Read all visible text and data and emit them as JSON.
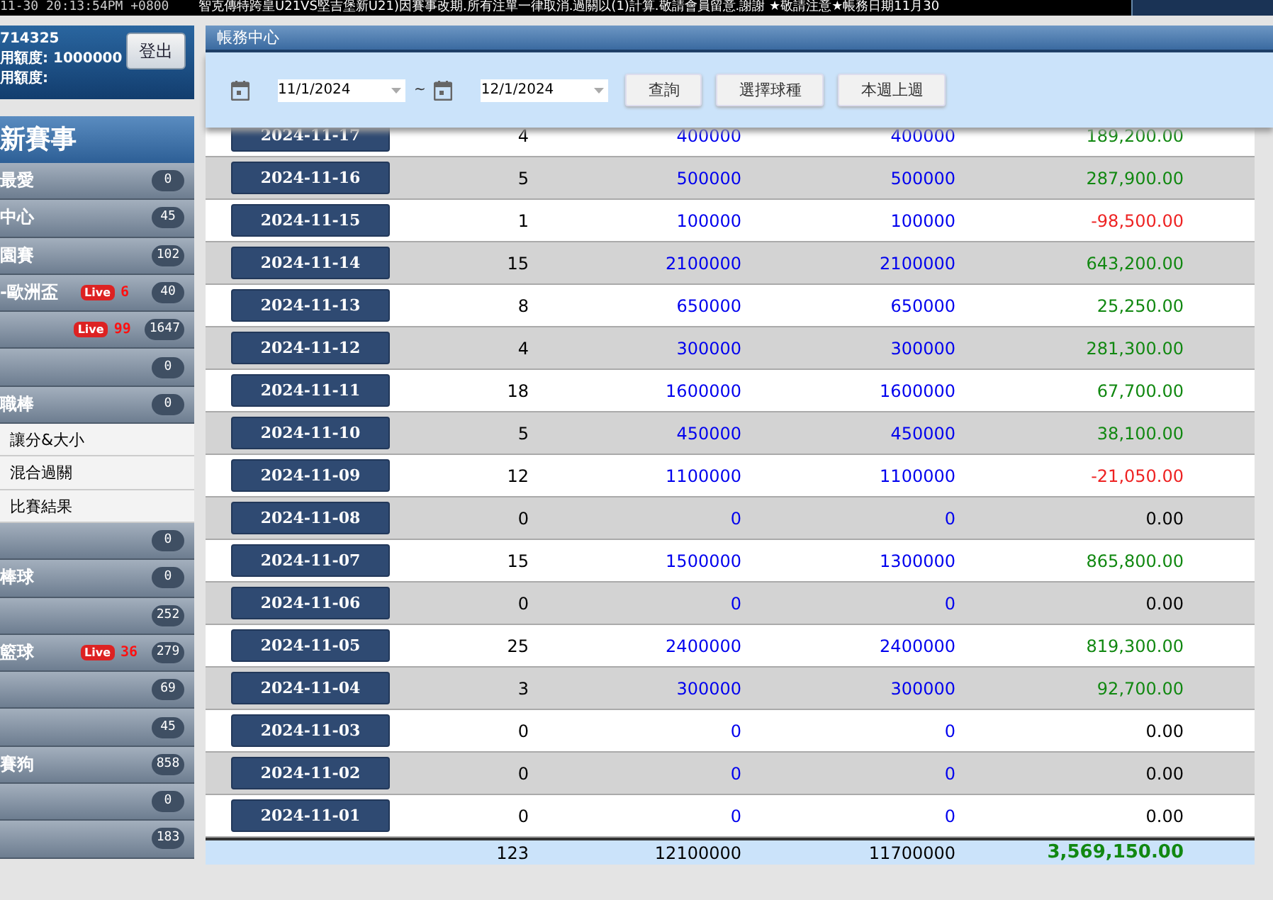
{
  "top_bar": {
    "clock": "11-30 20:13:54PM +0800",
    "marquee": "智克傳特跨皇U21VS堅吉堡新U21)因賽事改期.所有注單一律取消.過關以(1)計算.敬請會員留意.謝謝 ★敬請注意★帳務日期11月30"
  },
  "account": {
    "id": "714325",
    "credit_label": "用額度:",
    "credit_value": "1000000",
    "balance_label": "用額度:",
    "logout": "登出"
  },
  "sidebar": {
    "title": "新賽事",
    "items": [
      {
        "kind": "sport",
        "label": "最愛",
        "count": "0"
      },
      {
        "kind": "sport",
        "label": "中心",
        "count": "45"
      },
      {
        "kind": "sport",
        "label": "園賽",
        "count": "102"
      },
      {
        "kind": "sport",
        "label": "-歐洲盃",
        "live_badge": "Live",
        "live": "6",
        "count": "40"
      },
      {
        "kind": "sport",
        "live_badge": "Live",
        "live": "99",
        "count": "1647"
      },
      {
        "kind": "sport",
        "count": "0"
      },
      {
        "kind": "sport",
        "label": "職棒",
        "count": "0"
      },
      {
        "kind": "sub",
        "label": "讓分&大小"
      },
      {
        "kind": "sub",
        "label": "混合過關"
      },
      {
        "kind": "sub",
        "label": "比賽結果"
      },
      {
        "kind": "sport",
        "count": "0"
      },
      {
        "kind": "sport",
        "label": "棒球",
        "count": "0"
      },
      {
        "kind": "sport",
        "count": "252"
      },
      {
        "kind": "sport",
        "label": "籃球",
        "live_badge": "Live",
        "live": "36",
        "count": "279"
      },
      {
        "kind": "sport",
        "count": "69"
      },
      {
        "kind": "sport",
        "count": "45"
      },
      {
        "kind": "sport",
        "label": "賽狗",
        "count": "858"
      },
      {
        "kind": "sport",
        "count": "0"
      },
      {
        "kind": "sport",
        "count": "183"
      }
    ]
  },
  "panel": {
    "title": "帳務中心",
    "date_from": "11/1/2024",
    "separator": "~",
    "date_to": "12/1/2024",
    "buttons": [
      "查詢",
      "選擇球種",
      "本週上週"
    ]
  },
  "table": {
    "rows": [
      {
        "date": "2024-11-17",
        "count": "4",
        "amount": "400000",
        "valid": "400000",
        "result": "189,200.00",
        "kind": "gain"
      },
      {
        "date": "2024-11-16",
        "count": "5",
        "amount": "500000",
        "valid": "500000",
        "result": "287,900.00",
        "kind": "gain"
      },
      {
        "date": "2024-11-15",
        "count": "1",
        "amount": "100000",
        "valid": "100000",
        "result": "-98,500.00",
        "kind": "loss"
      },
      {
        "date": "2024-11-14",
        "count": "15",
        "amount": "2100000",
        "valid": "2100000",
        "result": "643,200.00",
        "kind": "gain"
      },
      {
        "date": "2024-11-13",
        "count": "8",
        "amount": "650000",
        "valid": "650000",
        "result": "25,250.00",
        "kind": "gain"
      },
      {
        "date": "2024-11-12",
        "count": "4",
        "amount": "300000",
        "valid": "300000",
        "result": "281,300.00",
        "kind": "gain"
      },
      {
        "date": "2024-11-11",
        "count": "18",
        "amount": "1600000",
        "valid": "1600000",
        "result": "67,700.00",
        "kind": "gain"
      },
      {
        "date": "2024-11-10",
        "count": "5",
        "amount": "450000",
        "valid": "450000",
        "result": "38,100.00",
        "kind": "gain"
      },
      {
        "date": "2024-11-09",
        "count": "12",
        "amount": "1100000",
        "valid": "1100000",
        "result": "-21,050.00",
        "kind": "loss"
      },
      {
        "date": "2024-11-08",
        "count": "0",
        "amount": "0",
        "valid": "0",
        "result": "0.00",
        "kind": "even"
      },
      {
        "date": "2024-11-07",
        "count": "15",
        "amount": "1500000",
        "valid": "1300000",
        "result": "865,800.00",
        "kind": "gain"
      },
      {
        "date": "2024-11-06",
        "count": "0",
        "amount": "0",
        "valid": "0",
        "result": "0.00",
        "kind": "even"
      },
      {
        "date": "2024-11-05",
        "count": "25",
        "amount": "2400000",
        "valid": "2400000",
        "result": "819,300.00",
        "kind": "gain"
      },
      {
        "date": "2024-11-04",
        "count": "3",
        "amount": "300000",
        "valid": "300000",
        "result": "92,700.00",
        "kind": "gain"
      },
      {
        "date": "2024-11-03",
        "count": "0",
        "amount": "0",
        "valid": "0",
        "result": "0.00",
        "kind": "even"
      },
      {
        "date": "2024-11-02",
        "count": "0",
        "amount": "0",
        "valid": "0",
        "result": "0.00",
        "kind": "even"
      },
      {
        "date": "2024-11-01",
        "count": "0",
        "amount": "0",
        "valid": "0",
        "result": "0.00",
        "kind": "even"
      }
    ],
    "total": {
      "count": "123",
      "amount": "12100000",
      "valid": "11700000",
      "result": "3,569,150.00",
      "kind": "gain"
    }
  }
}
